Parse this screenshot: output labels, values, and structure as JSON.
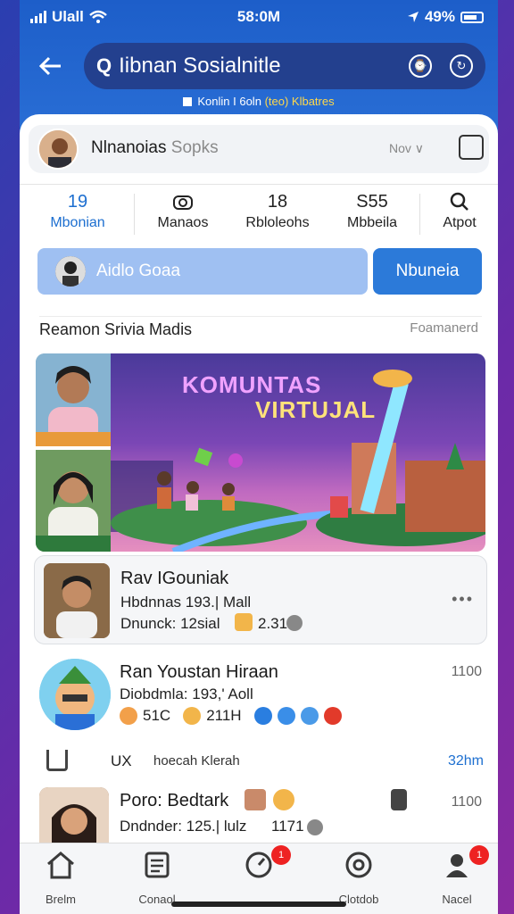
{
  "status_bar": {
    "carrier": "Ulall",
    "time": "58:0M",
    "battery": "49%"
  },
  "header": {
    "search_prefix": "Q",
    "title": "Iibnan Sosialnitle",
    "subline_main": "Konlin I 6oln",
    "subline_highlight": "(teo) Klbatres"
  },
  "profile": {
    "name": "Nlnanoias",
    "name_muted": "Sopks",
    "now_label": "Nov ∨"
  },
  "stats": [
    {
      "value": "19",
      "label": "Mbonian"
    },
    {
      "value": "",
      "label": "Manaos"
    },
    {
      "value": "18",
      "label": "Rbloleohs"
    },
    {
      "value": "S55",
      "label": "Mbbeila"
    },
    {
      "value": "",
      "label": "Atpot"
    }
  ],
  "actions": {
    "primary_label": "Aidlo Goaa",
    "secondary_label": "Nbuneia"
  },
  "section": {
    "title": "Reamon Srivia Madis",
    "right": "Foamanerd"
  },
  "hero": {
    "title_line1": "KOMUNTAS",
    "title_line2": "VIRTUJAL"
  },
  "posts": [
    {
      "name": "Rav IGouniak",
      "line1": "Hbdnnas 193.| Mall",
      "line2": "Dnunck: 12sial",
      "reaction_count": "2.31"
    },
    {
      "name": "Ran Youstan Hiraan",
      "line1": "Diobdmla: 193,' Aoll",
      "reaction1": "51C",
      "reaction2": "211H",
      "right": "1100"
    },
    {
      "name": "Poro: Bedtark",
      "line1": "Dndnder: 125.| lulz",
      "reaction": "1171",
      "right": "1100"
    }
  ],
  "repost": {
    "label": "UX",
    "text": "hoecah Klerah",
    "time": "32hm"
  },
  "nav": [
    {
      "label": "Brelm",
      "icon": "home-icon"
    },
    {
      "label": "Conaol",
      "icon": "list-icon"
    },
    {
      "label": "",
      "icon": "compass-icon",
      "badge": "1"
    },
    {
      "label": "Clotdob",
      "icon": "settings-icon"
    },
    {
      "label": "Nacel",
      "icon": "person-icon",
      "badge": "1"
    }
  ],
  "colors": {
    "header": "#1d5ec9",
    "accent": "#2c7ad9",
    "badge": "#ee2222"
  }
}
